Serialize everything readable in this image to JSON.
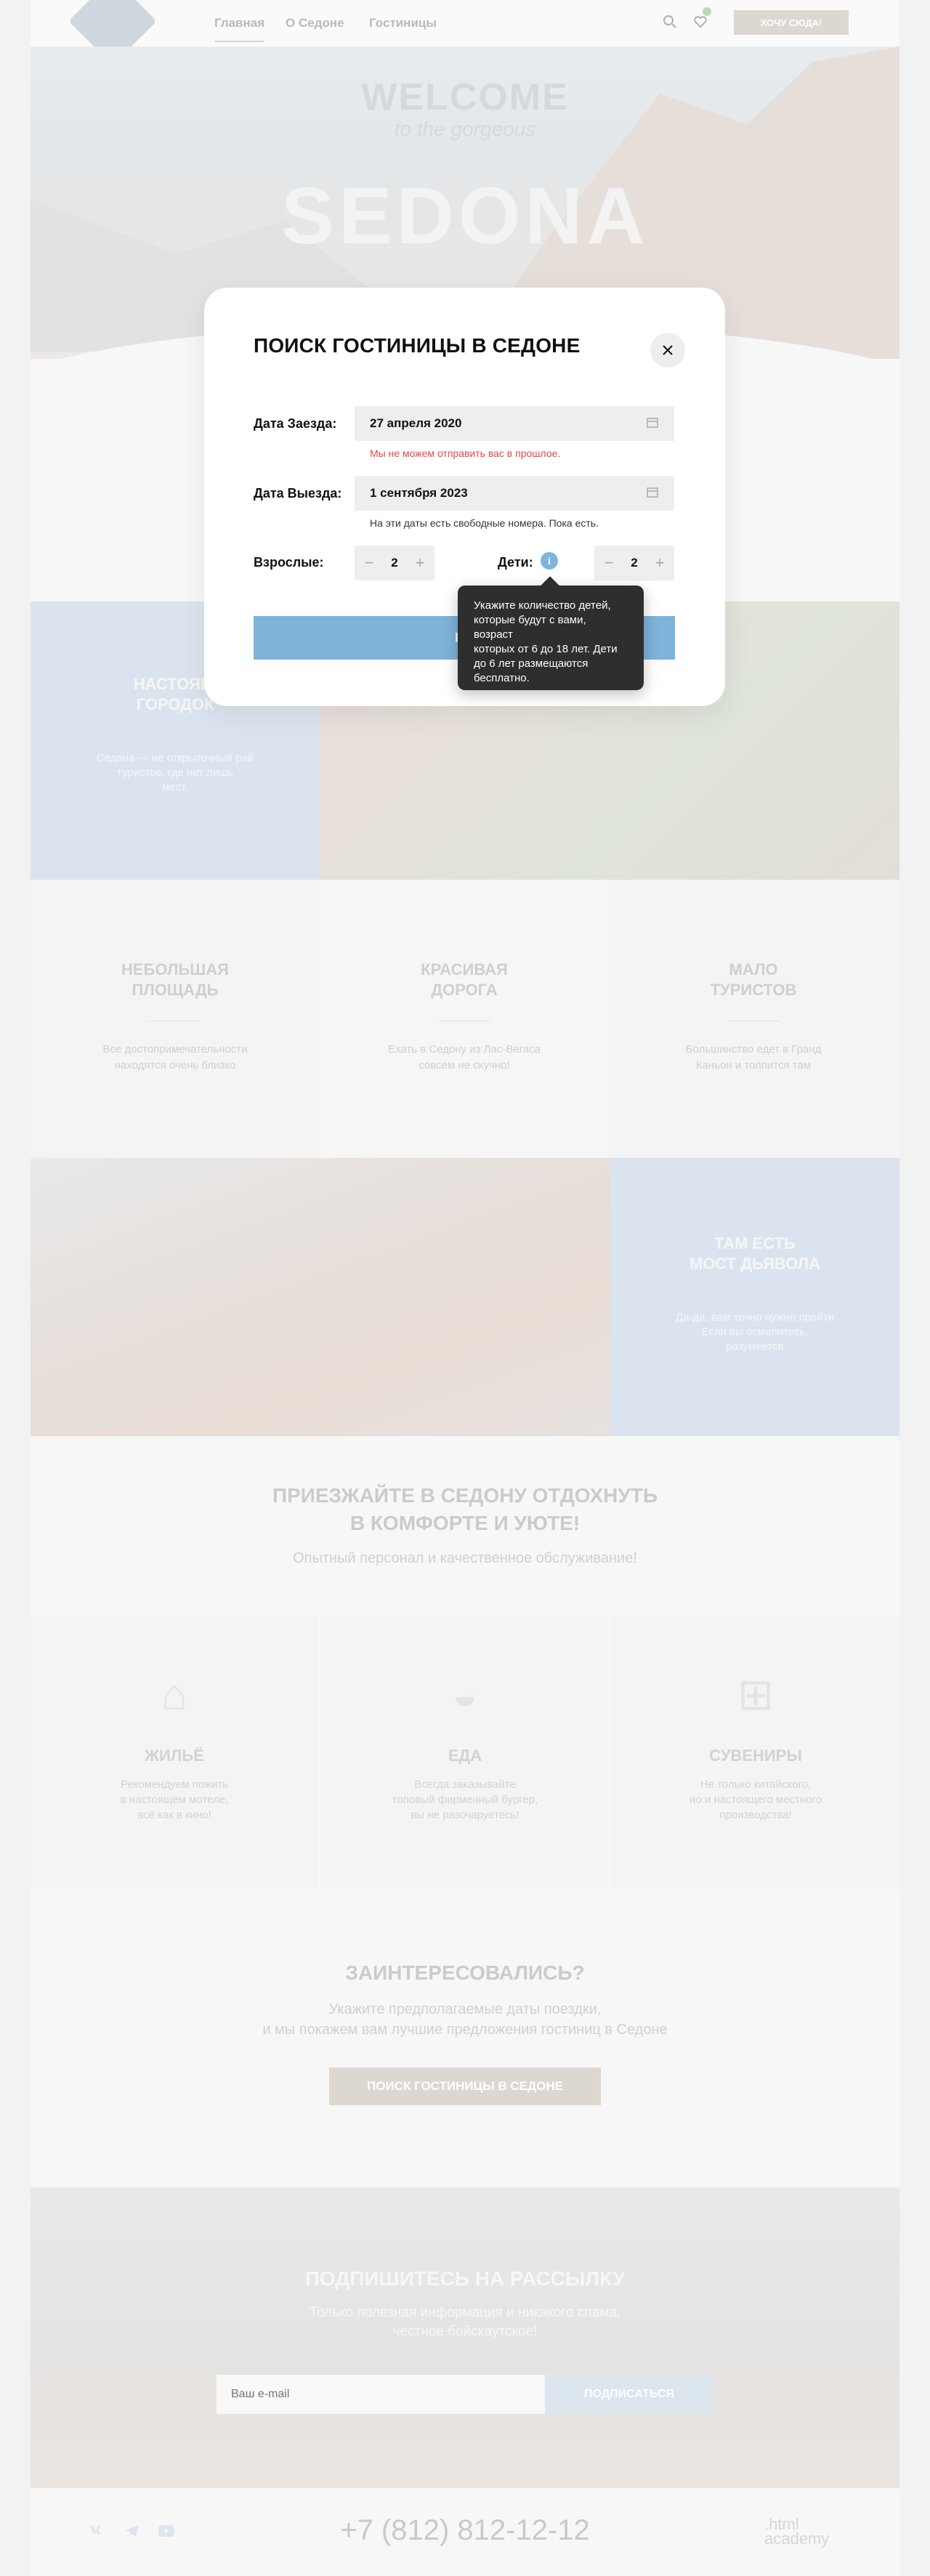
{
  "header": {
    "nav": [
      "Главная",
      "О Седоне",
      "Гостиницы"
    ],
    "cta": "ХОЧУ СЮДА!"
  },
  "hero": {
    "welcome": "WELCOME",
    "tagline": "to the gorgeous",
    "title": "SEDONA"
  },
  "sections": {
    "real_town": {
      "title_1": "НАСТОЯЩ",
      "title_2": "ГОРОДОК",
      "text_1": "Седона — не открыточный рай",
      "text_2": "туристов, где нет лишь",
      "text_3": "мест."
    },
    "three_features": [
      {
        "title_1": "НЕБОЛЬШАЯ",
        "title_2": "ПЛОЩАДЬ",
        "text_1": "Все достопримечательности",
        "text_2": "находятся очень близко"
      },
      {
        "title_1": "КРАСИВАЯ",
        "title_2": "ДОРОГА",
        "text_1": "Ехать в Седону из Лас-Вегаса",
        "text_2": "совсем не скучно!"
      },
      {
        "title_1": "МАЛО",
        "title_2": "ТУРИСТОВ",
        "text_1": "Большинство едет в Гранд",
        "text_2": "Каньон и толпится там"
      }
    ],
    "devil_bridge": {
      "title_1": "ТАМ ЕСТЬ",
      "title_2": "МОСТ ДЬЯВОЛА",
      "text_1": "Да-да, вам точно нужно пройти",
      "text_2": "Если вы осмелитесь,",
      "text_3": "разумеется"
    },
    "comfort": {
      "title_1": "ПРИЕЗЖАЙТЕ В СЕДОНУ ОТДОХНУТЬ",
      "title_2": "В КОМФОРТЕ И УЮТЕ!",
      "subtitle": "Опытный персонал и качественное обслуживание!"
    },
    "icons": [
      {
        "icon": "house-icon",
        "glyph": "⌂",
        "title": "ЖИЛЬЁ",
        "text_1": "Рекомендуем пожить",
        "text_2": "в настоящем мотеле,",
        "text_3": "всё как в кино!"
      },
      {
        "icon": "burger-icon",
        "glyph": "◒",
        "title": "ЕДА",
        "text_1": "Всегда заказывайте",
        "text_2": "топовый фирменный бургер,",
        "text_3": "вы не разочаруетесь!"
      },
      {
        "icon": "gift-icon",
        "glyph": "⊞",
        "title": "СУВЕНИРЫ",
        "text_1": "Не только китайского,",
        "text_2": "но и настоящего местного",
        "text_3": "производства!"
      }
    ],
    "interest": {
      "title": "ЗАИНТЕРЕСОВАЛИСЬ?",
      "text_1": "Укажите предполагаемые даты поездки,",
      "text_2": "и мы покажем вам лучшие предложения гостиниц в Седоне",
      "button": "ПОИСК ГОСТИНИЦЫ В СЕДОНЕ"
    },
    "subscribe": {
      "title": "ПОДПИШИТЕСЬ НА РАССЫЛКУ",
      "text_1": "Только полезная информация и никакого спама,",
      "text_2": "честное бойскаутское!",
      "placeholder": "Ваш e-mail",
      "button": "ПОДПИСАТЬСЯ"
    },
    "footer": {
      "phone": "+7 (812) 812-12-12",
      "academy_1": ".html",
      "academy_2": "academy"
    }
  },
  "modal": {
    "title": "ПОИСК ГОСТИНИЦЫ В СЕДОНЕ",
    "checkin_label": "Дата Заезда:",
    "checkin_value": "27 апреля 2020",
    "checkin_error": "Мы не можем отправить вас в прошлое.",
    "checkout_label": "Дата Выезда:",
    "checkout_value": "1 сентября 2023",
    "checkout_hint": "На эти даты есть свободные номера. Пока есть.",
    "adults_label": "Взрослые:",
    "adults_value": "2",
    "children_label": "Дети:",
    "children_value": "2",
    "info_glyph": "i",
    "submit_visible": "НА",
    "tooltip_1": "Укажите количество детей,",
    "tooltip_2": "которые будут с вами, возраст",
    "tooltip_3": "которых от 6 до 18 лет. Дети",
    "tooltip_4": "до 6 лет размещаются",
    "tooltip_5": "бесплатно."
  },
  "colors": {
    "accent": "#7eb4da",
    "error": "#e54848",
    "tooltip_bg": "#2e2e2e"
  }
}
